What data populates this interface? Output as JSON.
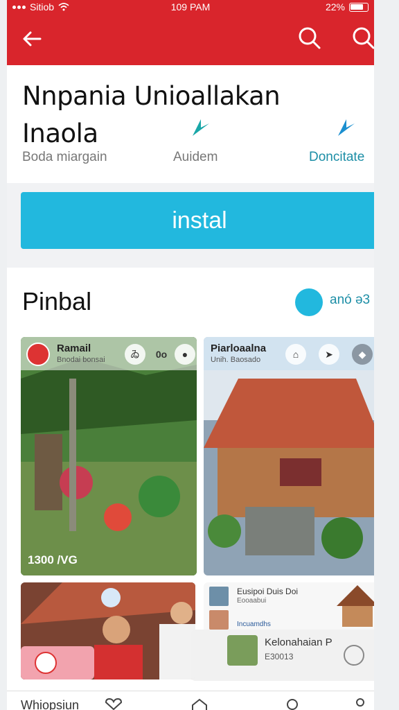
{
  "status_bar": {
    "carrier": "Sitiob",
    "time": "109 PAM",
    "battery": "22%"
  },
  "header": {
    "title": "Nnpania Unioallakan Inaola",
    "meta_left": "Boda miargain",
    "meta_mid": "Auidem",
    "meta_right": "Doncitate"
  },
  "install": {
    "label": "instal"
  },
  "section": {
    "title": "Pinbal",
    "badge_text": "anó ə3"
  },
  "card1": {
    "name": "Ramail",
    "sub": "Bnodai bonsai",
    "btn1": "ゐ",
    "btn2": "0o",
    "footer": "1300 /VG"
  },
  "card2": {
    "name": "Piarloaalna",
    "sub": "Unih. Baosado"
  },
  "card4": {
    "rows": [
      {
        "line1": "Eusipoi Duis Doi",
        "line2": "Eooaabui"
      },
      {
        "line1": "",
        "line2": "Incuamdhs"
      }
    ],
    "mini_title": "Kelonahaian P",
    "mini_sub": "E30013"
  },
  "bottom_nav": {
    "label": "Whiopsiun"
  },
  "colors": {
    "brand_red": "#d9252c",
    "accent_blue": "#22b8de",
    "link_teal": "#1c8ea6"
  },
  "icons": [
    "back-arrow-icon",
    "search-icon",
    "search-icon",
    "share-icon",
    "share-icon",
    "chat-icon",
    "heart-icon",
    "home-icon",
    "profile-icon"
  ]
}
